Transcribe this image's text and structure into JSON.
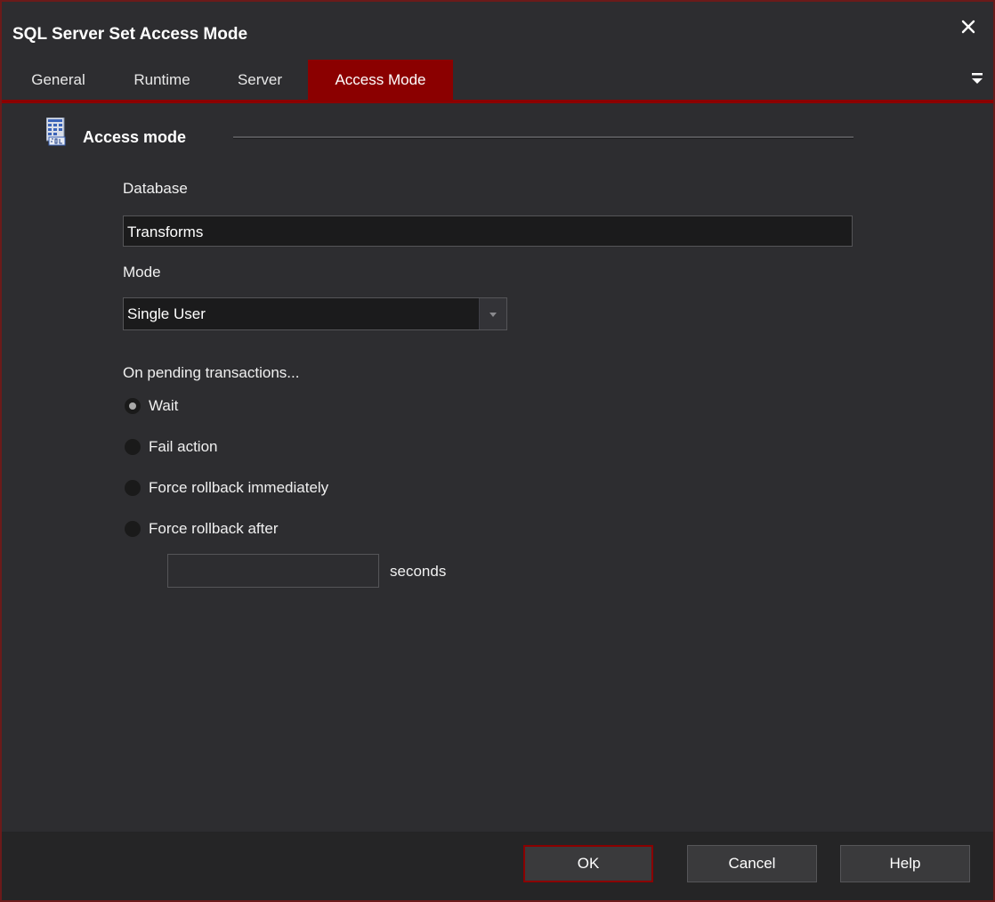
{
  "window": {
    "title": "SQL Server Set Access Mode"
  },
  "tabs": [
    {
      "label": "General",
      "active": false
    },
    {
      "label": "Runtime",
      "active": false
    },
    {
      "label": "Server",
      "active": false
    },
    {
      "label": "Access Mode",
      "active": true
    }
  ],
  "section": {
    "title": "Access mode",
    "icon": "sql-table-icon"
  },
  "database": {
    "label": "Database",
    "value": "Transforms"
  },
  "mode": {
    "label": "Mode",
    "selected": "Single User"
  },
  "pending": {
    "label": "On pending transactions...",
    "options": [
      {
        "label": "Wait",
        "checked": true
      },
      {
        "label": "Fail action",
        "checked": false
      },
      {
        "label": "Force rollback immediately",
        "checked": false
      },
      {
        "label": "Force rollback after",
        "checked": false
      }
    ],
    "seconds_value": "",
    "seconds_label": "seconds"
  },
  "buttons": {
    "ok": "OK",
    "cancel": "Cancel",
    "help": "Help"
  },
  "colors": {
    "accent": "#8b0000",
    "background": "#2d2d30",
    "field": "#1b1b1c"
  }
}
